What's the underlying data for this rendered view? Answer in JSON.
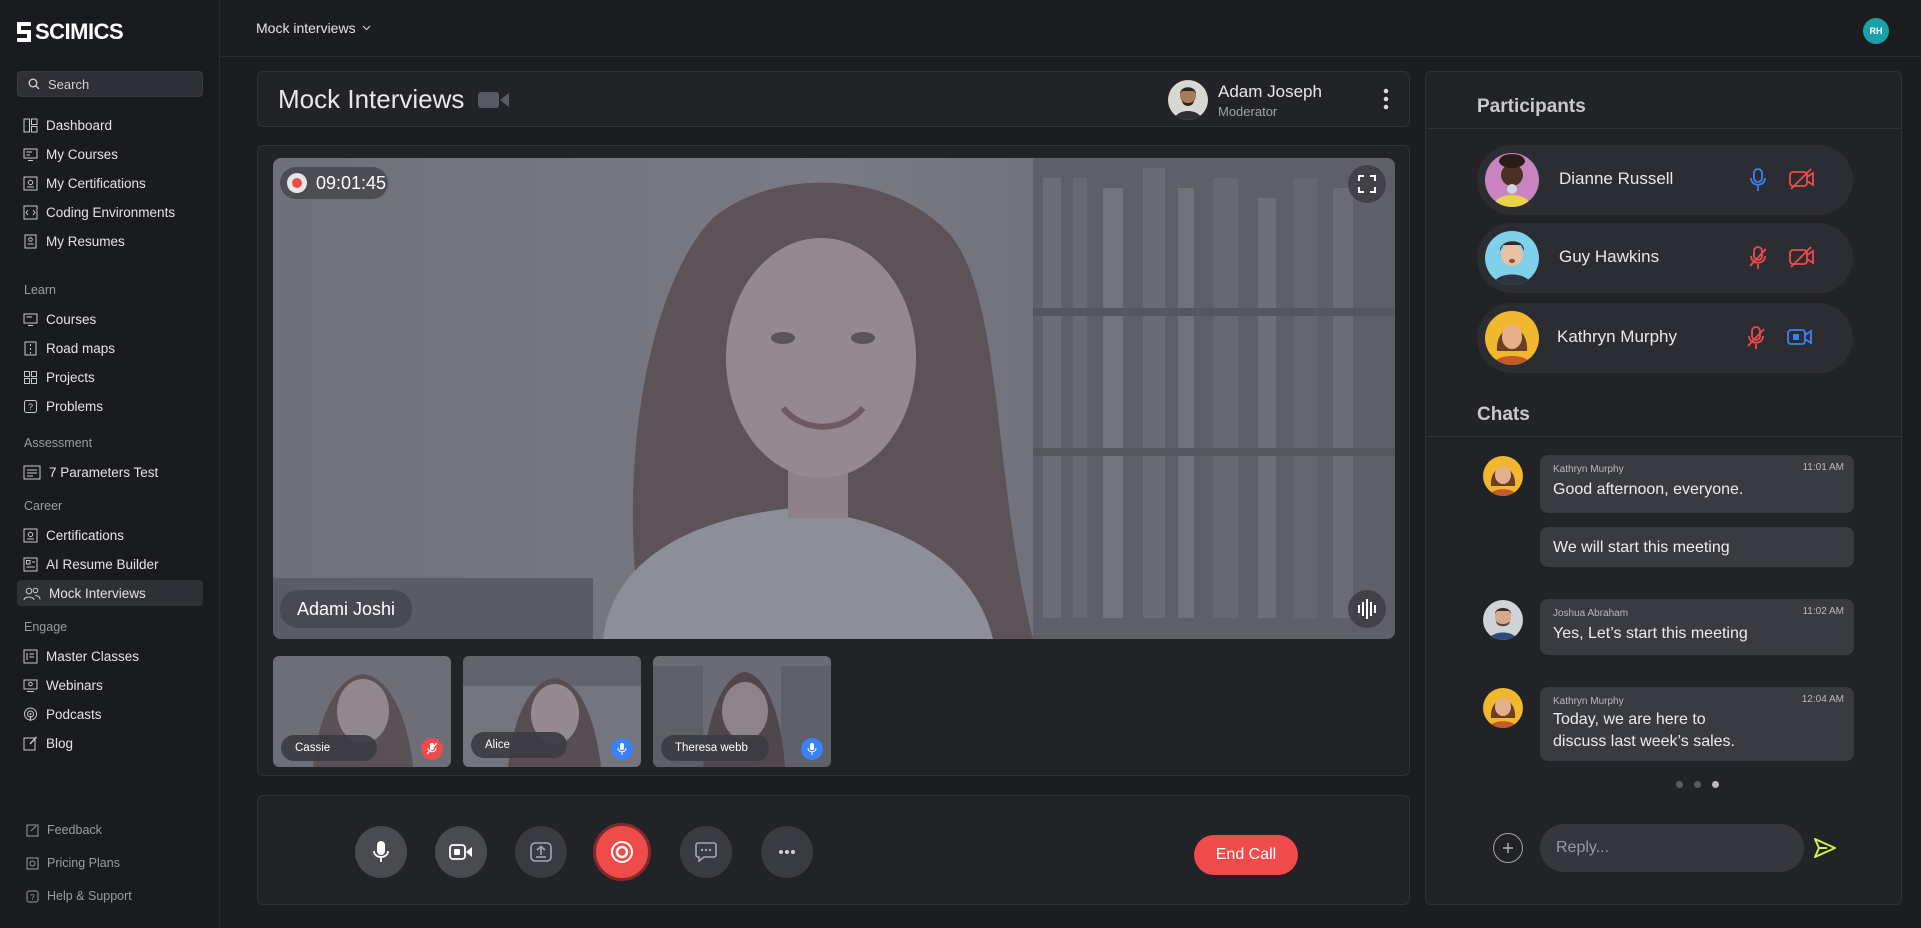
{
  "brand": {
    "name": "SCIMICS"
  },
  "search": {
    "placeholder": "Search"
  },
  "sidebar": {
    "top_items": [
      {
        "label": "Dashboard",
        "icon": "dashboard-icon"
      },
      {
        "label": "My Courses",
        "icon": "monitor-icon"
      },
      {
        "label": "My Certifications",
        "icon": "certificate-icon"
      },
      {
        "label": "Coding Environments",
        "icon": "code-icon"
      },
      {
        "label": "My Resumes",
        "icon": "resume-icon"
      }
    ],
    "sections": [
      {
        "title": "Learn",
        "items": [
          {
            "label": "Courses",
            "icon": "monitor-icon"
          },
          {
            "label": "Road maps",
            "icon": "roadmap-icon"
          },
          {
            "label": "Projects",
            "icon": "grid-icon"
          },
          {
            "label": "Problems",
            "icon": "problem-icon"
          }
        ]
      },
      {
        "title": "Assessment",
        "items": [
          {
            "label": "7 Parameters Test",
            "icon": "test-icon"
          }
        ]
      },
      {
        "title": "Career",
        "items": [
          {
            "label": "Certifications",
            "icon": "certificate-icon"
          },
          {
            "label": "AI Resume Builder",
            "icon": "builder-icon"
          },
          {
            "label": "Mock Interviews",
            "icon": "people-icon",
            "active": true
          }
        ]
      },
      {
        "title": "Engage",
        "items": [
          {
            "label": "Master Classes",
            "icon": "class-icon"
          },
          {
            "label": "Webinars",
            "icon": "webinar-icon"
          },
          {
            "label": "Podcasts",
            "icon": "podcast-icon"
          },
          {
            "label": "Blog",
            "icon": "blog-icon"
          }
        ]
      }
    ],
    "footer": [
      {
        "label": "Feedback",
        "icon": "feedback-icon"
      },
      {
        "label": "Pricing Plans",
        "icon": "pricing-icon"
      },
      {
        "label": "Help & Support",
        "icon": "help-icon"
      }
    ]
  },
  "topbar": {
    "breadcrumb": "Mock interviews",
    "user_initials": "RH"
  },
  "meeting": {
    "title": "Mock Interviews",
    "moderator": {
      "name": "Adam Joseph",
      "role": "Moderator"
    },
    "timer": "09:01:45",
    "main_speaker": "Adami Joshi",
    "thumbnails": [
      {
        "name": "Cassie",
        "mic": "muted"
      },
      {
        "name": "Alice",
        "mic": "on"
      },
      {
        "name": "Theresa webb",
        "mic": "on"
      }
    ],
    "end_call_label": "End Call"
  },
  "participants": {
    "title": "Participants",
    "list": [
      {
        "name": "Dianne Russell",
        "mic": "on",
        "camera": "off"
      },
      {
        "name": "Guy Hawkins",
        "mic": "off",
        "camera": "off"
      },
      {
        "name": "Kathryn Murphy",
        "mic": "off",
        "camera": "on"
      }
    ]
  },
  "chats": {
    "title": "Chats",
    "messages": [
      {
        "sender": "Kathryn Murphy",
        "time": "11:01 AM",
        "text": "Good afternoon, everyone."
      },
      {
        "text": "We will start this meeting"
      },
      {
        "sender": "Joshua Abraham",
        "time": "11:02 AM",
        "text": "Yes, Let’s start this meeting"
      },
      {
        "sender": "Kathryn Murphy",
        "time": "12:04 AM",
        "text_lines": [
          "Today, we are here to",
          "discuss last week’s sales."
        ]
      }
    ],
    "reply_placeholder": "Reply..."
  },
  "colors": {
    "accent_blue": "#3b82f6",
    "danger_red": "#f04b4b",
    "send_yellow": "#d4f24a",
    "teal_avatar": "#1aa0a8"
  }
}
